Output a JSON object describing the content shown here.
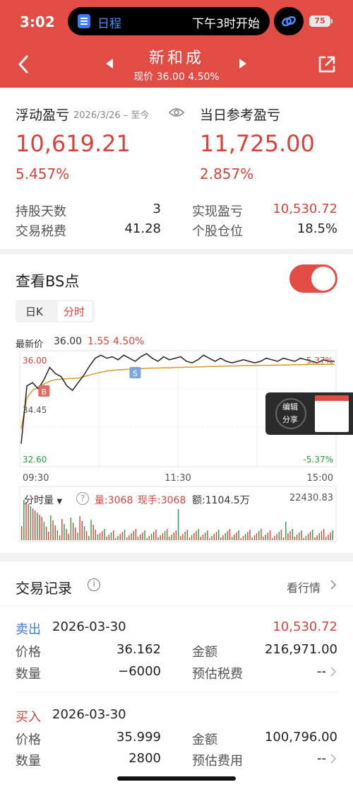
{
  "status_bar": {
    "time": "3:02",
    "island_label": "日程",
    "island_event": "下午3时开始",
    "battery": "75"
  },
  "header": {
    "stock_name": "新和成",
    "quote": "现价 36.00 4.50%"
  },
  "profit": {
    "float_label": "浮动盈亏",
    "date_range": "2026/3/26 – 至今",
    "float_value": "10,619.21",
    "float_pct": "5.457%",
    "day_label": "当日参考盈亏",
    "day_value": "11,725.00",
    "day_pct": "2.857%",
    "rows": [
      {
        "left_label": "持股天数",
        "left_value": "3",
        "right_label": "实现盈亏",
        "right_value": "10,530.72",
        "right_red": true
      },
      {
        "left_label": "交易税费",
        "left_value": "41.28",
        "right_label": "个股仓位",
        "right_value": "18.5%",
        "right_red": false
      }
    ]
  },
  "bs": {
    "title": "查看BS点",
    "tabs": [
      "日K",
      "分时"
    ],
    "active_tab": 1,
    "toggle_on": true
  },
  "chart_data": {
    "type": "line",
    "latest_label": "最新价",
    "latest_price": "36.00",
    "latest_change": "1.55",
    "latest_pct": "4.50%",
    "y_top_label": "36.00",
    "y_mid_label": "34.45",
    "y_bottom_label": "32.60",
    "pct_top_label": "5.37%",
    "pct_bottom_label": "-5.37%",
    "x_labels": [
      "09:30",
      "11:30",
      "15:00"
    ],
    "ylim": [
      32.6,
      36.3
    ],
    "price_series": [
      33.3,
      35.2,
      35.3,
      35.1,
      35.4,
      35.8,
      35.6,
      35.5,
      35.2,
      35.05,
      35.3,
      35.55,
      35.85,
      36.1,
      36.2,
      36.1,
      36.15,
      36.05,
      36.2,
      36.1,
      36.0,
      36.15,
      36.25,
      36.1,
      36.0,
      36.15,
      36.05,
      36.1,
      36.15,
      36.0,
      35.95,
      36.05,
      36.2,
      36.1,
      36.0,
      36.1,
      36.0,
      35.95,
      36.0,
      36.05,
      36.0,
      35.95,
      36.0,
      36.1,
      36.05,
      36.0,
      36.1,
      36.05,
      36.0,
      36.1,
      36.05,
      36.0,
      35.95,
      36.05,
      36.0,
      36.0
    ],
    "avg_series": [
      33.8,
      34.8,
      35.05,
      35.15,
      35.25,
      35.35,
      35.4,
      35.42,
      35.43,
      35.44,
      35.45,
      35.5,
      35.55,
      35.6,
      35.64,
      35.68,
      35.7,
      35.72,
      35.73,
      35.74,
      35.75,
      35.76,
      35.77,
      35.78,
      35.78,
      35.79,
      35.79,
      35.8,
      35.8,
      35.81,
      35.81,
      35.82,
      35.82,
      35.83,
      35.83,
      35.84,
      35.84,
      35.85,
      35.85,
      35.86,
      35.86,
      35.86,
      35.87,
      35.87,
      35.87,
      35.88,
      35.88,
      35.88,
      35.89,
      35.89,
      35.89,
      35.9,
      35.9,
      35.9,
      35.9,
      35.9
    ],
    "markers": [
      {
        "label": "B",
        "index": 4
      },
      {
        "label": "S",
        "index": 20
      }
    ]
  },
  "volume": {
    "mode_label": "分时量",
    "vol_label": "量:3068",
    "now_label": "现手:3068",
    "amount_label": "额:1104.5万",
    "max_label": "22430.83"
  },
  "overlay": {
    "edit_label": "编辑",
    "share_label": "分享"
  },
  "trades": {
    "title": "交易记录",
    "view_label": "看行情",
    "records": [
      {
        "type": "卖出",
        "date": "2026-03-30",
        "amount": "10,530.72",
        "price_label": "价格",
        "price": "36.162",
        "money_label": "金额",
        "money": "216,971.00",
        "qty_label": "数量",
        "qty": "−6000",
        "fee_label": "预估税费",
        "fee": "--"
      },
      {
        "type": "买入",
        "date": "2026-03-30",
        "amount": "",
        "price_label": "价格",
        "price": "35.999",
        "money_label": "金额",
        "money": "100,796.00",
        "qty_label": "数量",
        "qty": "2800",
        "fee_label": "预估费用",
        "fee": "--"
      }
    ]
  },
  "colors": {
    "header": "#e14d44",
    "up": "#d8423a",
    "down": "#2a9a3a",
    "sell": "#3c7bd6",
    "buy": "#d8423a"
  }
}
